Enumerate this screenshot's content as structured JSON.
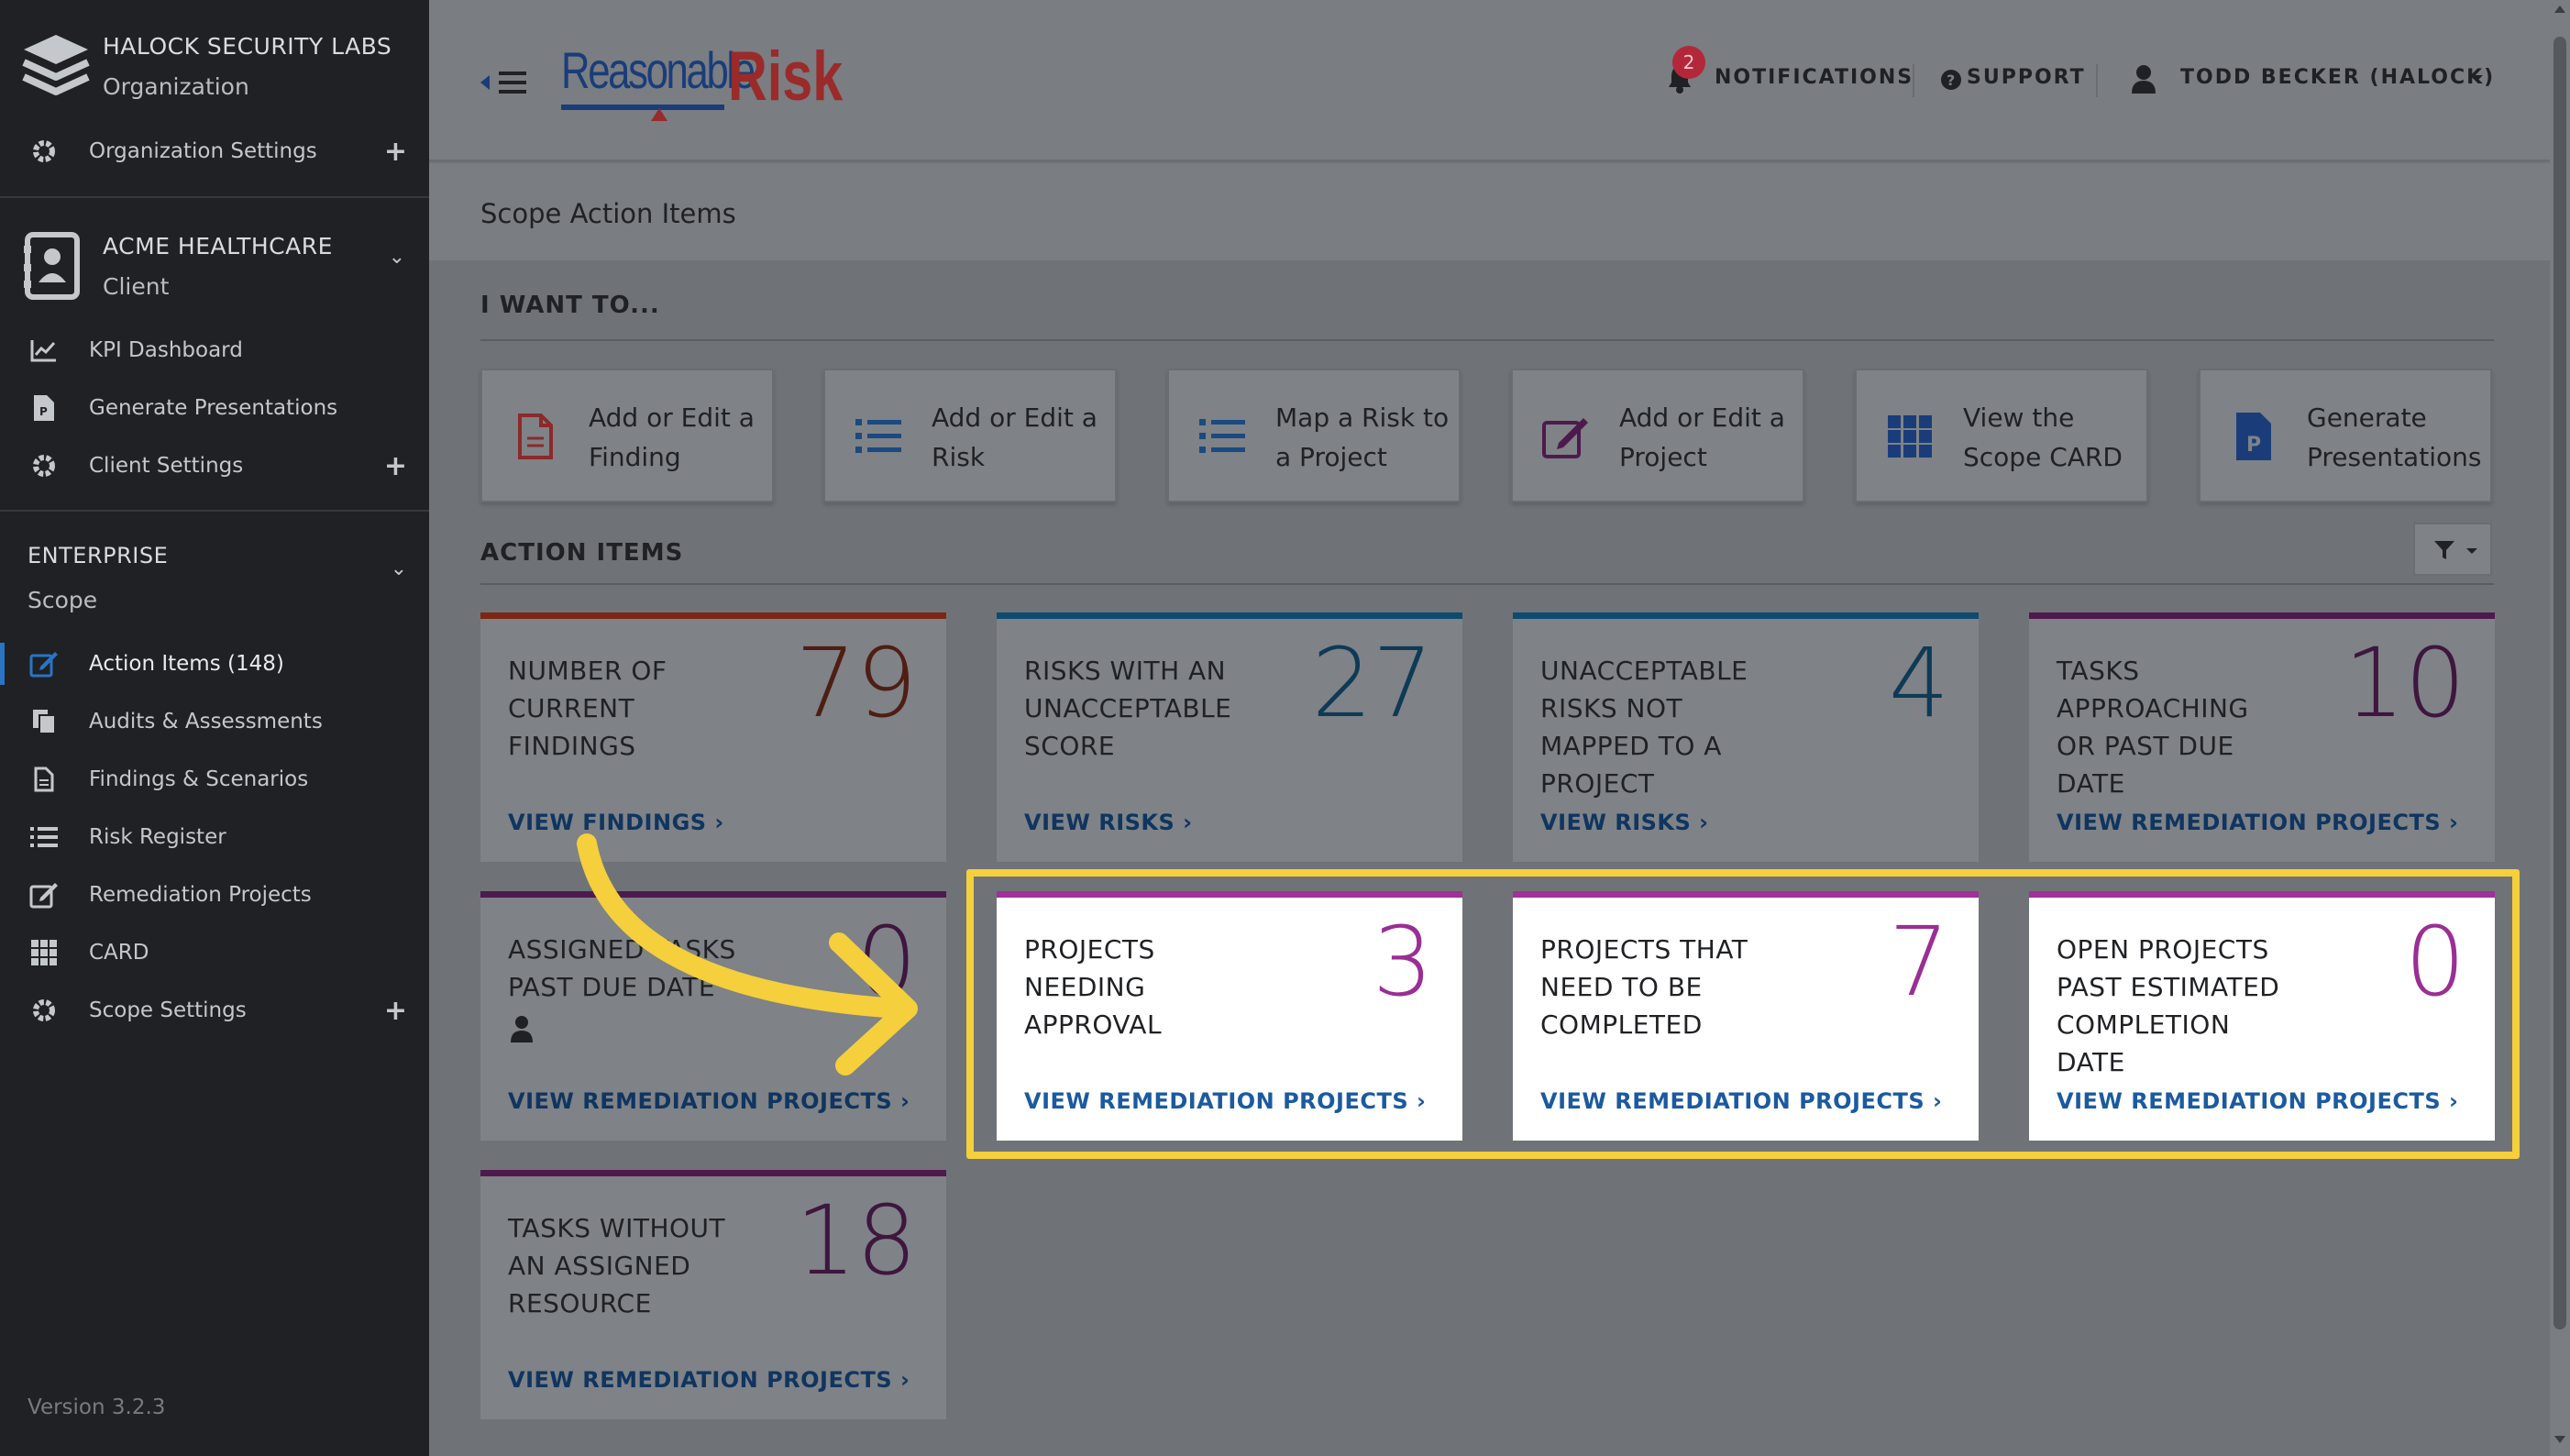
{
  "sidebar": {
    "org": {
      "name": "HALOCK SECURITY LABS",
      "subtitle": "Organization",
      "settings": "Organization Settings"
    },
    "client": {
      "name": "ACME HEALTHCARE",
      "subtitle": "Client",
      "items": [
        "KPI Dashboard",
        "Generate Presentations",
        "Client Settings"
      ]
    },
    "enterprise": {
      "title": "ENTERPRISE",
      "subtitle": "Scope",
      "items": [
        "Action Items (148)",
        "Audits & Assessments",
        "Findings & Scenarios",
        "Risk Register",
        "Remediation Projects",
        "CARD",
        "Scope Settings"
      ]
    },
    "version": "Version 3.2.3"
  },
  "topbar": {
    "logo_left": "Reasonable",
    "logo_right": "Risk",
    "notifications": "NOTIFICATIONS",
    "notification_count": "2",
    "support": "SUPPORT",
    "user": "TODD BECKER (HALOCK)"
  },
  "page": {
    "title": "Scope Action Items",
    "want_to_heading": "I WANT TO...",
    "action_items_heading": "ACTION ITEMS"
  },
  "quick_actions": [
    {
      "line1": "Add or Edit a",
      "line2": "Finding",
      "icon": "file-icon"
    },
    {
      "line1": "Add or Edit a",
      "line2": "Risk",
      "icon": "list-icon"
    },
    {
      "line1": "Map a Risk to",
      "line2": "a Project",
      "icon": "list-icon"
    },
    {
      "line1": "Add or Edit a",
      "line2": "Project",
      "icon": "edit-icon"
    },
    {
      "line1": "View the",
      "line2": "Scope CARD",
      "icon": "grid-icon"
    },
    {
      "line1": "Generate",
      "line2": "Presentations",
      "icon": "presentation-file-icon"
    }
  ],
  "cards": [
    {
      "title": [
        "NUMBER OF",
        "CURRENT",
        "FINDINGS"
      ],
      "count": "79",
      "link": "VIEW FINDINGS",
      "color": "#7d2614"
    },
    {
      "title": [
        "RISKS WITH AN",
        "UNACCEPTABLE",
        "SCORE"
      ],
      "count": "27",
      "link": "VIEW RISKS",
      "color": "#0e4a6e"
    },
    {
      "title": [
        "UNACCEPTABLE",
        "RISKS NOT",
        "MAPPED TO A",
        "PROJECT"
      ],
      "count": "4",
      "link": "VIEW RISKS",
      "color": "#0e4a6e"
    },
    {
      "title": [
        "TASKS",
        "APPROACHING",
        "OR PAST DUE",
        "DATE"
      ],
      "count": "10",
      "link": "VIEW REMEDIATION PROJECTS",
      "color": "#4e1a4e"
    },
    {
      "title": [
        "ASSIGNED TASKS",
        "PAST DUE DATE"
      ],
      "count": "0",
      "link": "VIEW REMEDIATION PROJECTS",
      "color": "#4e1a4e"
    },
    {
      "title": [
        "PROJECTS",
        "NEEDING",
        "APPROVAL"
      ],
      "count": "3",
      "link": "VIEW REMEDIATION PROJECTS",
      "color": "#a0309a"
    },
    {
      "title": [
        "PROJECTS THAT",
        "NEED TO BE",
        "COMPLETED"
      ],
      "count": "7",
      "link": "VIEW REMEDIATION PROJECTS",
      "color": "#a0309a"
    },
    {
      "title": [
        "OPEN PROJECTS",
        "PAST ESTIMATED",
        "COMPLETION",
        "DATE"
      ],
      "count": "0",
      "link": "VIEW REMEDIATION PROJECTS",
      "color": "#a0309a"
    },
    {
      "title": [
        "TASKS WITHOUT",
        "AN ASSIGNED",
        "RESOURCE"
      ],
      "count": "18",
      "link": "VIEW REMEDIATION PROJECTS",
      "color": "#4e1a4e"
    }
  ],
  "colors": {
    "highlight": "#f5cf3c",
    "link_blue_dim": "#0f3560",
    "link_blue": "#1b5aa0"
  }
}
